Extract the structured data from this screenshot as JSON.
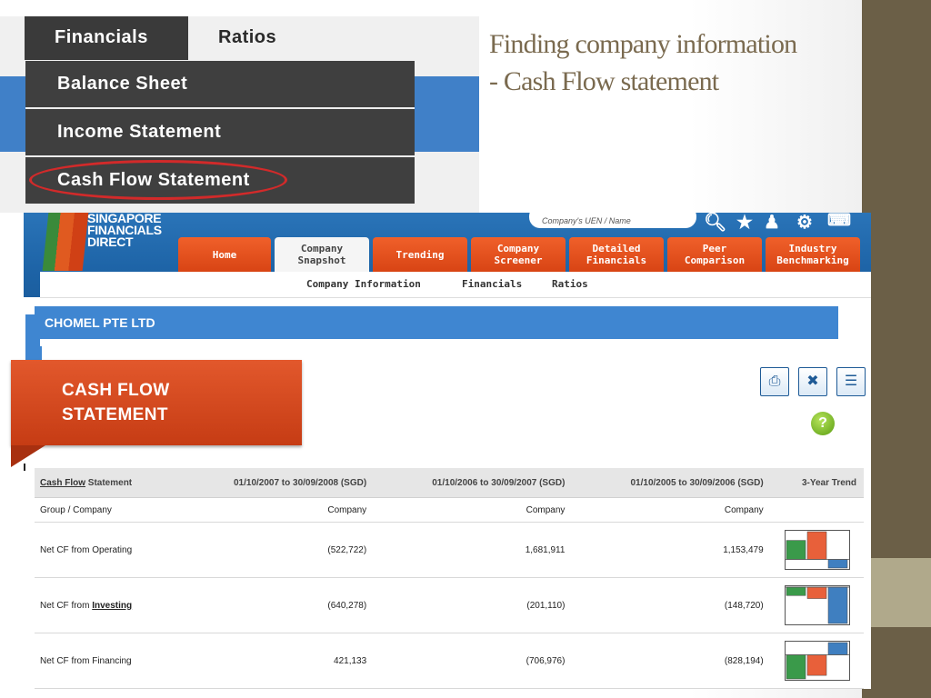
{
  "slide": {
    "title_line1": "Finding company information",
    "title_line2": "-  Cash Flow statement"
  },
  "menu": {
    "tabs": [
      "Financials",
      "Ratios"
    ],
    "dropdown_items": [
      "Balance Sheet",
      "Income Statement",
      "Cash Flow Statement"
    ]
  },
  "site": {
    "logo_lines": [
      "SINGAPORE",
      "FINANCIALS",
      "DIRECT"
    ],
    "search_placeholder": "Company's UEN / Name",
    "nav_tabs": [
      {
        "line1": "Home",
        "line2": ""
      },
      {
        "line1": "Company",
        "line2": "Snapshot"
      },
      {
        "line1": "Trending",
        "line2": ""
      },
      {
        "line1": "Company",
        "line2": "Screener"
      },
      {
        "line1": "Detailed",
        "line2": "Financials"
      },
      {
        "line1": "Peer",
        "line2": "Comparison"
      },
      {
        "line1": "Industry",
        "line2": "Benchmarking"
      }
    ],
    "subnav": [
      "Company Information",
      "Financials",
      "Ratios"
    ],
    "company_name": "CHOMEL PTE LTD",
    "callout_line1": "CASH FLOW",
    "callout_line2": "STATEMENT",
    "help_glyph": "?",
    "action_icons": [
      "print-icon",
      "export-excel-icon",
      "clipboard-icon"
    ]
  },
  "table": {
    "header": {
      "first_link": "Cash Flow",
      "first_rest": " Statement",
      "periods": [
        "01/10/2007 to 30/09/2008 (SGD)",
        "01/10/2006 to 30/09/2007 (SGD)",
        "01/10/2005 to 30/09/2006 (SGD)"
      ],
      "trend": "3-Year Trend"
    },
    "sub_row": {
      "label": "Group / Company",
      "values": [
        "Company",
        "Company",
        "Company"
      ]
    },
    "rows": [
      {
        "label": "Net CF from Operating",
        "label_link": "",
        "values": [
          "(522,722)",
          "1,681,911",
          "1,153,479"
        ],
        "raw": [
          -522722,
          1681911,
          1153479
        ]
      },
      {
        "label": "Net CF from ",
        "label_link": "Investing",
        "values": [
          "(640,278)",
          "(201,110)",
          "(148,720)"
        ],
        "raw": [
          -640278,
          -201110,
          -148720
        ]
      },
      {
        "label": "Net CF from Financing",
        "label_link": "",
        "values": [
          "421,133",
          "(706,976)",
          "(828,194)"
        ],
        "raw": [
          421133,
          -706976,
          -828194
        ]
      }
    ]
  },
  "colors": {
    "trend_green": "#3a9a4a",
    "trend_orange": "#e8603a",
    "trend_blue": "#3f7fc0"
  }
}
